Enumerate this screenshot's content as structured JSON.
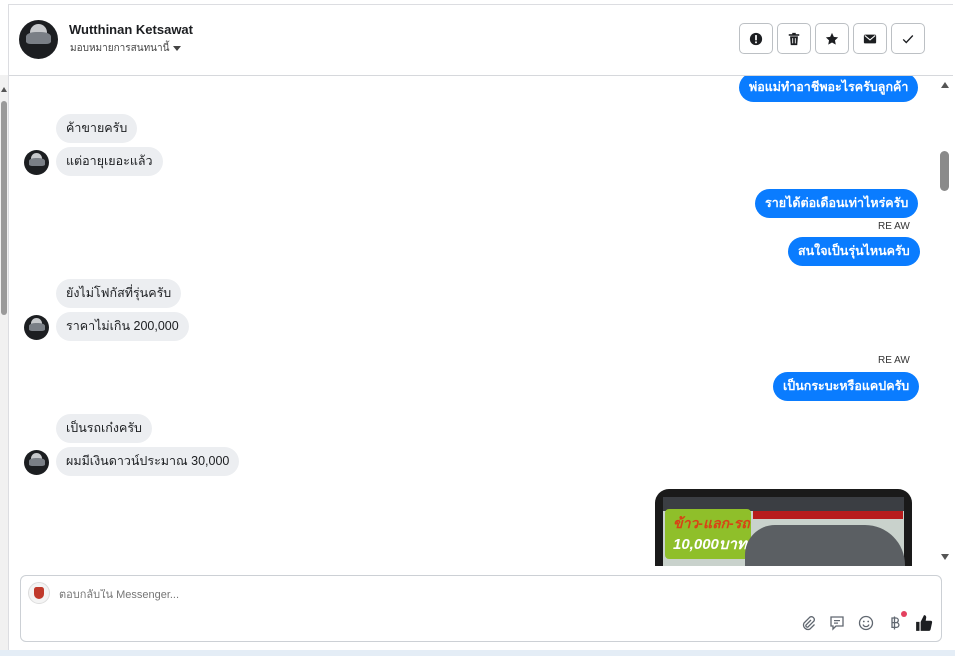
{
  "header": {
    "name": "Wutthinan Ketsawat",
    "assign_label": "มอบหมายการสนทนานี้",
    "actions": [
      {
        "icon": "alert-icon",
        "name": "spam-button"
      },
      {
        "icon": "trash-icon",
        "name": "delete-button"
      },
      {
        "icon": "star-icon",
        "name": "star-button"
      },
      {
        "icon": "mail-icon",
        "name": "unread-button"
      },
      {
        "icon": "check-icon",
        "name": "done-button"
      }
    ]
  },
  "messages": {
    "m1": "พ่อแม่ทำอาชีพอะไรครับลูกค้า",
    "m2": "ค้าขายครับ",
    "m3": "แต่อายุเยอะแล้ว",
    "m4": "รายได้ต่อเดือนเท่าไหร่ครับ",
    "m5_sender": "RE AW",
    "m5": "สนใจเป็นรุ่นไหนครับ",
    "m6": "ยังไม่โฟกัสที่รุ่นครับ",
    "m7": "ราคาไม่เกิน 200,000",
    "m8_sender": "RE AW",
    "m8": "เป็นกระบะหรือแคปครับ",
    "m9": "เป็นรถเก๋งครับ",
    "m10": "ผมมีเงินดาวน์ประมาณ  30,000",
    "image": {
      "headline": "ข้าว-แลก-รถ",
      "amount": "10,000บาท"
    }
  },
  "composer": {
    "placeholder": "ตอบกลับใน Messenger...",
    "icons": [
      "paperclip-icon",
      "saved-reply-icon",
      "emoji-icon",
      "baht-icon",
      "thumbs-up-icon"
    ]
  },
  "colors": {
    "outgoing": "#0a7cff",
    "incoming": "#eceef1"
  }
}
